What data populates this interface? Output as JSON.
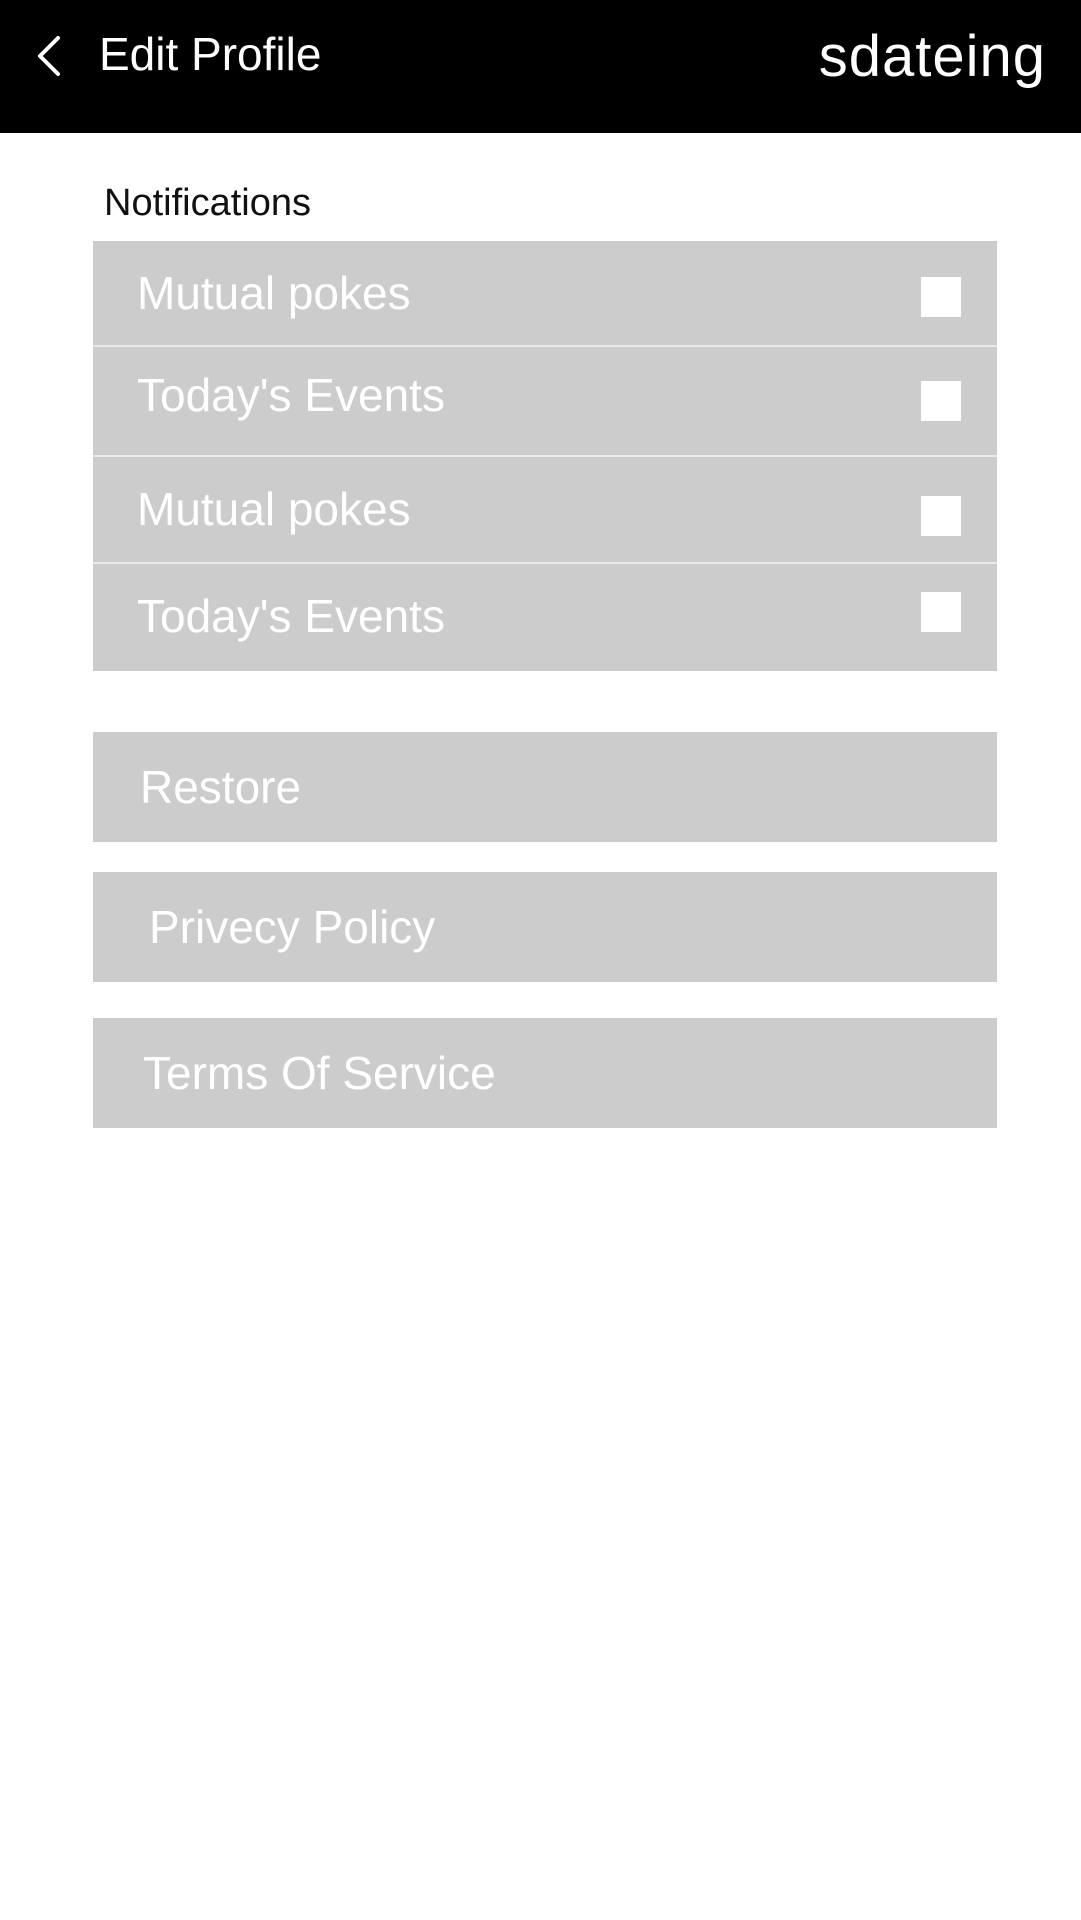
{
  "header": {
    "title": "Edit Profile",
    "brand": "sdateing",
    "back_icon": "chevron-left-icon",
    "background": "#000000"
  },
  "notifications": {
    "section_label": "Notifications",
    "items": [
      {
        "label": "Mutual pokes",
        "checked": false
      },
      {
        "label": "Today's Events",
        "checked": false
      },
      {
        "label": "Mutual pokes",
        "checked": false
      },
      {
        "label": "Today's Events",
        "checked": false
      }
    ]
  },
  "actions": {
    "restore": "Restore",
    "privacy_policy": "Privecy Policy",
    "terms_of_service": "Terms Of Service"
  },
  "colors": {
    "panel": "#cccccc",
    "panel_text": "#ffffff"
  }
}
